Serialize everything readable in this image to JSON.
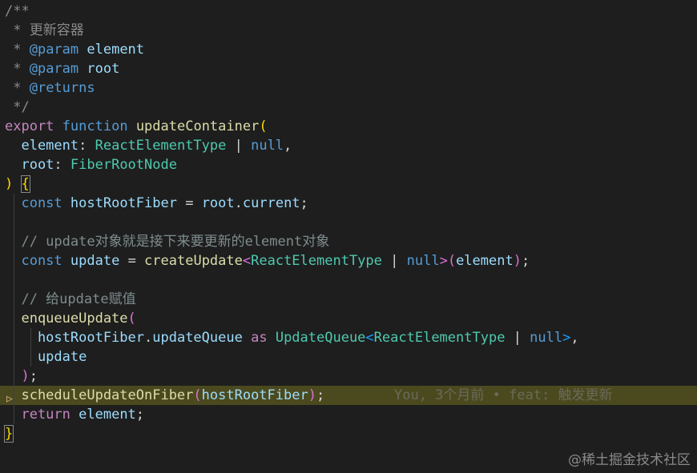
{
  "code_lines": [
    [
      {
        "t": "/**",
        "c": "c-doc"
      }
    ],
    [
      {
        "t": " * 更新容器",
        "c": "c-doc"
      }
    ],
    [
      {
        "t": " * ",
        "c": "c-doc"
      },
      {
        "t": "@param",
        "c": "c-tag"
      },
      {
        "t": " element",
        "c": "c-var"
      }
    ],
    [
      {
        "t": " * ",
        "c": "c-doc"
      },
      {
        "t": "@param",
        "c": "c-tag"
      },
      {
        "t": " root",
        "c": "c-var"
      }
    ],
    [
      {
        "t": " * ",
        "c": "c-doc"
      },
      {
        "t": "@returns",
        "c": "c-tag"
      }
    ],
    [
      {
        "t": " */",
        "c": "c-doc"
      }
    ],
    [
      {
        "t": "export",
        "c": "c-kw"
      },
      {
        "t": " ",
        "c": "c-plain"
      },
      {
        "t": "function",
        "c": "c-decl"
      },
      {
        "t": " ",
        "c": "c-plain"
      },
      {
        "t": "updateContainer",
        "c": "c-fn"
      },
      {
        "t": "(",
        "c": "c-paren2"
      }
    ],
    [
      {
        "t": "  element",
        "c": "c-var"
      },
      {
        "t": ": ",
        "c": "c-plain"
      },
      {
        "t": "ReactElementType",
        "c": "c-type"
      },
      {
        "t": " | ",
        "c": "c-plain"
      },
      {
        "t": "null",
        "c": "c-decl"
      },
      {
        "t": ",",
        "c": "c-plain"
      }
    ],
    [
      {
        "t": "  root",
        "c": "c-var"
      },
      {
        "t": ": ",
        "c": "c-plain"
      },
      {
        "t": "FiberRootNode",
        "c": "c-type"
      }
    ],
    [
      {
        "t": ")",
        "c": "c-paren2"
      },
      {
        "t": " ",
        "c": "c-plain"
      },
      {
        "t": "{",
        "c": "c-paren2",
        "box": true
      }
    ],
    [
      {
        "t": "  const",
        "c": "c-decl"
      },
      {
        "t": " ",
        "c": "c-plain"
      },
      {
        "t": "hostRootFiber",
        "c": "c-var"
      },
      {
        "t": " = ",
        "c": "c-plain"
      },
      {
        "t": "root",
        "c": "c-var"
      },
      {
        "t": ".",
        "c": "c-plain"
      },
      {
        "t": "current",
        "c": "c-var"
      },
      {
        "t": ";",
        "c": "c-plain"
      }
    ],
    [],
    [
      {
        "t": "  // update对象就是接下来要更新的element对象",
        "c": "c-comment"
      }
    ],
    [
      {
        "t": "  const",
        "c": "c-decl"
      },
      {
        "t": " ",
        "c": "c-plain"
      },
      {
        "t": "update",
        "c": "c-var"
      },
      {
        "t": " = ",
        "c": "c-plain"
      },
      {
        "t": "createUpdate",
        "c": "c-fn"
      },
      {
        "t": "<",
        "c": "c-paren1"
      },
      {
        "t": "ReactElementType",
        "c": "c-type"
      },
      {
        "t": " | ",
        "c": "c-plain"
      },
      {
        "t": "null",
        "c": "c-decl"
      },
      {
        "t": ">",
        "c": "c-paren1"
      },
      {
        "t": "(",
        "c": "c-paren1"
      },
      {
        "t": "element",
        "c": "c-var"
      },
      {
        "t": ")",
        "c": "c-paren1"
      },
      {
        "t": ";",
        "c": "c-plain"
      }
    ],
    [],
    [
      {
        "t": "  // 给update赋值",
        "c": "c-comment"
      }
    ],
    [
      {
        "t": "  enqueueUpdate",
        "c": "c-fn"
      },
      {
        "t": "(",
        "c": "c-paren1"
      }
    ],
    [
      {
        "t": "    hostRootFiber",
        "c": "c-var"
      },
      {
        "t": ".",
        "c": "c-plain"
      },
      {
        "t": "updateQueue",
        "c": "c-var"
      },
      {
        "t": " ",
        "c": "c-plain"
      },
      {
        "t": "as",
        "c": "c-kw"
      },
      {
        "t": " ",
        "c": "c-plain"
      },
      {
        "t": "UpdateQueue",
        "c": "c-type"
      },
      {
        "t": "<",
        "c": "c-paren3"
      },
      {
        "t": "ReactElementType",
        "c": "c-type"
      },
      {
        "t": " | ",
        "c": "c-plain"
      },
      {
        "t": "null",
        "c": "c-decl"
      },
      {
        "t": ">",
        "c": "c-paren3"
      },
      {
        "t": ",",
        "c": "c-plain"
      }
    ],
    [
      {
        "t": "    update",
        "c": "c-var"
      }
    ],
    [
      {
        "t": "  ",
        "c": "c-plain"
      },
      {
        "t": ")",
        "c": "c-paren1"
      },
      {
        "t": ";",
        "c": "c-plain"
      }
    ],
    [
      {
        "t": "  scheduleUpdateOnFiber",
        "c": "c-fn"
      },
      {
        "t": "(",
        "c": "c-paren1"
      },
      {
        "t": "hostRootFiber",
        "c": "c-var"
      },
      {
        "t": ")",
        "c": "c-paren1"
      },
      {
        "t": ";",
        "c": "c-plain"
      }
    ],
    [
      {
        "t": "  return",
        "c": "c-kw"
      },
      {
        "t": " ",
        "c": "c-plain"
      },
      {
        "t": "element",
        "c": "c-var"
      },
      {
        "t": ";",
        "c": "c-plain"
      }
    ],
    [
      {
        "t": "}",
        "c": "c-paren2",
        "box": true
      }
    ]
  ],
  "current_line_index": 20,
  "blame_text": "You, 3个月前 • feat: 触发更新",
  "gutter_icon": "debug-arrow-icon",
  "watermark": "@稀土掘金技术社区",
  "colors": {
    "background": "#1e1e1e",
    "current_line": "#4b4a1f",
    "keyword": "#c586c0",
    "function": "#dcdcaa",
    "variable": "#9cdcfe",
    "type": "#4ec9b0"
  }
}
